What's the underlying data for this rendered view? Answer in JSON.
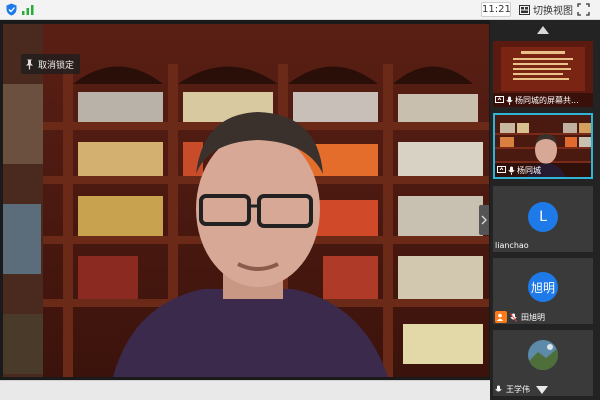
{
  "topbar": {
    "time": "11:21",
    "switch_view_label": "切换视图"
  },
  "main": {
    "unlock_label": "取消锁定"
  },
  "participants": [
    {
      "name": "杨同城的屏幕共...",
      "type": "screen-share"
    },
    {
      "name": "杨同城",
      "type": "video",
      "active": true
    },
    {
      "name": "lianchao",
      "type": "avatar",
      "avatar_text": "L"
    },
    {
      "name": "田旭明",
      "type": "avatar",
      "avatar_text": "旭明"
    },
    {
      "name": "王学伟",
      "type": "photo"
    }
  ],
  "colors": {
    "accent": "#2fb4d7",
    "avatar_bg": "#1e7ae8",
    "shield": "#1e7ae8",
    "signal": "#27ae3a"
  }
}
